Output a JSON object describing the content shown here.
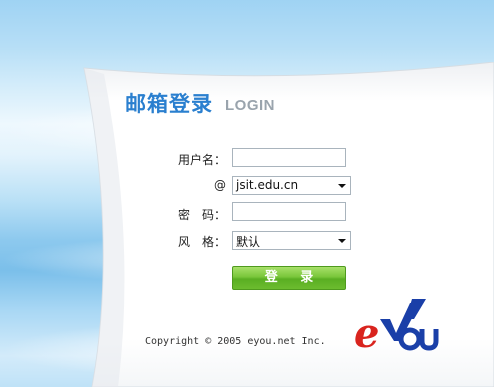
{
  "login": {
    "title_cn": "邮箱登录",
    "title_en": "LOGIN",
    "username_label": "用户名：",
    "username_value": "",
    "domain_label": "@",
    "domain_value": "jsit.edu.cn",
    "password_label": "密　码：",
    "password_value": "",
    "style_label": "风　格：",
    "style_value": "默认",
    "submit_label": "登 录"
  },
  "footer": {
    "copyright": "Copyright © 2005 eyou.net Inc."
  },
  "logo": {
    "text": "eYou",
    "colors": {
      "e": "#d9241e",
      "you": "#1a3fa8"
    }
  },
  "colors": {
    "title": "#2a7fcf",
    "button": "#6cbc2f",
    "panel": "#ffffff",
    "sky": "#8dc9ee"
  },
  "icons": [
    "dropdown-arrow-icon"
  ]
}
